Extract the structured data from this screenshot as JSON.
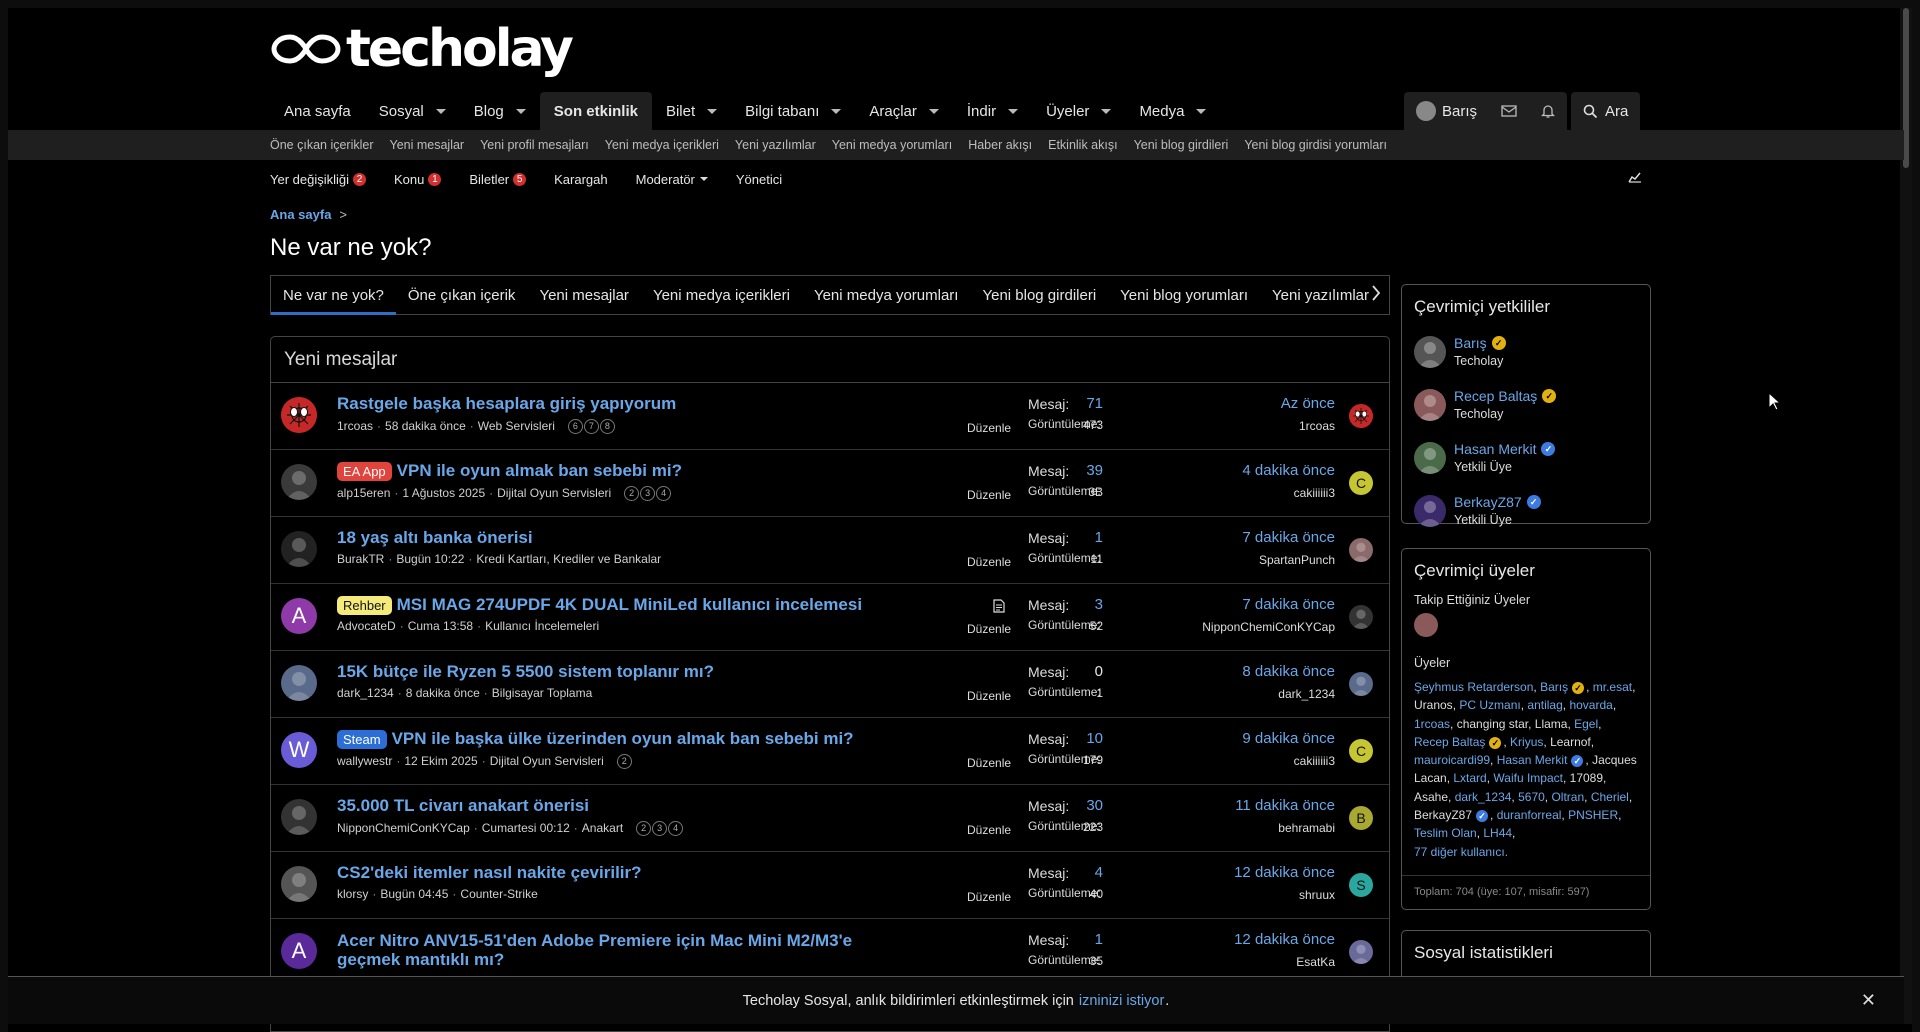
{
  "brand": {
    "logo_text": "techolay"
  },
  "nav": {
    "items": [
      {
        "label": "Ana sayfa",
        "caret": false,
        "active": false
      },
      {
        "label": "Sosyal",
        "caret": true,
        "active": false
      },
      {
        "label": "Blog",
        "caret": true,
        "active": false
      },
      {
        "label": "Son etkinlik",
        "caret": false,
        "active": true
      },
      {
        "label": "Bilet",
        "caret": true,
        "active": false
      },
      {
        "label": "Bilgi tabanı",
        "caret": true,
        "active": false
      },
      {
        "label": "Araçlar",
        "caret": true,
        "active": false
      },
      {
        "label": "İndir",
        "caret": true,
        "active": false
      },
      {
        "label": "Üyeler",
        "caret": true,
        "active": false
      },
      {
        "label": "Medya",
        "caret": true,
        "active": false
      }
    ],
    "user_name": "Barış",
    "search_label": "Ara"
  },
  "subnav": [
    "Öne çıkan içerikler",
    "Yeni mesajlar",
    "Yeni profil mesajları",
    "Yeni medya içerikleri",
    "Yeni yazılımlar",
    "Yeni medya yorumları",
    "Haber akışı",
    "Etkinlik akışı",
    "Yeni blog girdileri",
    "Yeni blog girdisi yorumları"
  ],
  "modbar": {
    "items": [
      {
        "label": "Yer değişikliği",
        "badge": "2"
      },
      {
        "label": "Konu",
        "badge": "1"
      },
      {
        "label": "Biletler",
        "badge": "5"
      },
      {
        "label": "Karargah",
        "badge": ""
      },
      {
        "label": "Moderatör",
        "badge": "",
        "caret": true
      },
      {
        "label": "Yönetici",
        "badge": ""
      }
    ]
  },
  "breadcrumb": {
    "home": "Ana sayfa",
    "sep": ">"
  },
  "page_title": "Ne var ne yok?",
  "tabs": [
    "Ne var ne yok?",
    "Öne çıkan içerik",
    "Yeni mesajlar",
    "Yeni medya içerikleri",
    "Yeni medya yorumları",
    "Yeni blog girdileri",
    "Yeni blog yorumları",
    "Yeni yazılımlar"
  ],
  "block_title": "Yeni mesajlar",
  "stat_labels": {
    "replies": "Mesaj:",
    "views": "Görüntüleme:",
    "edit": "Düzenle"
  },
  "threads": [
    {
      "title": "Rastgele başka hesaplara giriş yapıyorum",
      "prefix": "",
      "author": "1rcoas",
      "date": "58 dakika önce",
      "forum": "Web Servisleri",
      "pages": [
        "6",
        "7",
        "8"
      ],
      "replies": "71",
      "views": "473",
      "last_time": "Az önce",
      "last_user": "1rcoas",
      "av": {
        "type": "spider",
        "color": "#c62828"
      },
      "lav": {
        "type": "spider",
        "color": "#c62828"
      }
    },
    {
      "title": "VPN ile oyun almak ban sebebi mi?",
      "prefix": "EA App",
      "prefix_bg": "#e0443c",
      "prefix_fg": "#ffffff",
      "author": "alp15eren",
      "date": "1 Ağustos 2025",
      "forum": "Dijital Oyun Servisleri",
      "pages": [
        "2",
        "3",
        "4"
      ],
      "replies": "39",
      "views": "3B",
      "last_time": "4 dakika önce",
      "last_user": "cakiiiiii3",
      "av": {
        "type": "photo",
        "color": "#3a3a3a"
      },
      "lav": {
        "type": "letter",
        "letter": "C",
        "color": "#c6c632"
      }
    },
    {
      "title": "18 yaş altı banka önerisi",
      "prefix": "",
      "author": "BurakTR",
      "date": "Bugün 10:22",
      "forum": "Kredi Kartları, Krediler ve Bankalar",
      "pages": [],
      "replies": "1",
      "views": "11",
      "last_time": "7 dakika önce",
      "last_user": "SpartanPunch",
      "av": {
        "type": "photo",
        "color": "#222"
      },
      "lav": {
        "type": "photo",
        "color": "#8a6a6a"
      }
    },
    {
      "title": "MSI MAG 274UPDF 4K DUAL MiniLed kullanıcı incelemesi",
      "prefix": "Rehber",
      "prefix_bg": "#f5eb7a",
      "prefix_fg": "#111111",
      "author": "AdvocateD",
      "date": "Cuma 13:58",
      "forum": "Kullanıcı İncelemeleri",
      "pages": [],
      "replies": "3",
      "views": "52",
      "last_time": "7 dakika önce",
      "last_user": "NipponChemiConKYCap",
      "av": {
        "type": "letter",
        "letter": "A",
        "color": "#8e3aa8"
      },
      "lav": {
        "type": "photo",
        "color": "#333"
      },
      "post_icon": true
    },
    {
      "title": "15K bütçe ile Ryzen 5 5500 sistem toplanır mı?",
      "prefix": "",
      "author": "dark_1234",
      "date": "8 dakika önce",
      "forum": "Bilgisayar Toplama",
      "pages": [],
      "replies": "0",
      "views": "1",
      "last_time": "8 dakika önce",
      "last_user": "dark_1234",
      "av": {
        "type": "photo",
        "color": "#5a6a8a"
      },
      "lav": {
        "type": "photo",
        "color": "#5a6a8a"
      },
      "replies_plain": true
    },
    {
      "title": "VPN ile başka ülke üzerinden oyun almak ban sebebi mi?",
      "prefix": "Steam",
      "prefix_bg": "#2b6fd6",
      "prefix_fg": "#ffffff",
      "author": "wallywestr",
      "date": "12 Ekim 2025",
      "forum": "Dijital Oyun Servisleri",
      "pages": [
        "2"
      ],
      "replies": "10",
      "views": "179",
      "last_time": "9 dakika önce",
      "last_user": "cakiiiiii3",
      "av": {
        "type": "letter",
        "letter": "W",
        "color": "#6a5bd6"
      },
      "lav": {
        "type": "letter",
        "letter": "C",
        "color": "#c6c632"
      }
    },
    {
      "title": "35.000 TL civarı anakart önerisi",
      "prefix": "",
      "author": "NipponChemiConKYCap",
      "date": "Cumartesi 00:12",
      "forum": "Anakart",
      "pages": [
        "2",
        "3",
        "4"
      ],
      "replies": "30",
      "views": "223",
      "last_time": "11 dakika önce",
      "last_user": "behramabi",
      "av": {
        "type": "photo",
        "color": "#333"
      },
      "lav": {
        "type": "letter",
        "letter": "B",
        "color": "#a8a832"
      }
    },
    {
      "title": "CS2'deki itemler nasıl nakite çevirilir?",
      "prefix": "",
      "author": "klorsy",
      "date": "Bugün 04:45",
      "forum": "Counter-Strike",
      "pages": [],
      "replies": "4",
      "views": "40",
      "last_time": "12 dakika önce",
      "last_user": "shruux",
      "av": {
        "type": "photo",
        "color": "#555"
      },
      "lav": {
        "type": "letter",
        "letter": "S",
        "color": "#2aa8a0"
      }
    },
    {
      "title": "Acer Nitro ANV15-51'den Adobe Premiere için Mac Mini M2/M3'e geçmek mantıklı mı?",
      "prefix": "",
      "author": "",
      "date": "",
      "forum": "",
      "pages": [],
      "replies": "1",
      "views": "35",
      "last_time": "12 dakika önce",
      "last_user": "EsatKa",
      "av": {
        "type": "letter",
        "letter": "A",
        "color": "#5a2a9a"
      },
      "lav": {
        "type": "photo",
        "color": "#6a6a9a"
      }
    }
  ],
  "sidebar": {
    "staff_title": "Çevrimiçi yetkililer",
    "staff": [
      {
        "name": "Barış",
        "role": "Techolay",
        "badge": "gold",
        "color": "#555"
      },
      {
        "name": "Recep Baltaş",
        "role": "Techolay",
        "badge": "gold",
        "color": "#8a5a5a"
      },
      {
        "name": "Hasan Merkit",
        "role": "Yetkili Üye",
        "badge": "blue",
        "color": "#4a6a4a"
      },
      {
        "name": "BerkayZ87",
        "role": "Yetkili Üye",
        "badge": "blue",
        "color": "#3a2a6a"
      }
    ],
    "online_title": "Çevrimiçi üyeler",
    "following_label": "Takip Ettiğiniz Üyeler",
    "members_label": "Üyeler",
    "members": [
      {
        "n": "Şeyhmus Retarderson",
        "l": true
      },
      {
        "n": "Barış",
        "l": true,
        "b": "gold"
      },
      {
        "n": "mr.esat",
        "l": true
      },
      {
        "n": "Uranos",
        "l": false
      },
      {
        "n": "PC Uzmanı",
        "l": true
      },
      {
        "n": "antilag",
        "l": true
      },
      {
        "n": "hovarda",
        "l": true
      },
      {
        "n": "1rcoas",
        "l": true
      },
      {
        "n": "changing star",
        "l": false
      },
      {
        "n": "Llama",
        "l": false
      },
      {
        "n": "Egel",
        "l": true
      },
      {
        "n": "Recep Baltaş",
        "l": true,
        "b": "gold"
      },
      {
        "n": "Kriyus",
        "l": true
      },
      {
        "n": "Learnof",
        "l": false
      },
      {
        "n": "mauroicardi99",
        "l": true
      },
      {
        "n": "Hasan Merkit",
        "l": true,
        "b": "blue"
      },
      {
        "n": "Jacques Lacan",
        "l": false
      },
      {
        "n": "Lxtard",
        "l": true
      },
      {
        "n": "Waifu Impact",
        "l": true
      },
      {
        "n": "17089",
        "l": false
      },
      {
        "n": "Asahe",
        "l": false
      },
      {
        "n": "dark_1234",
        "l": true
      },
      {
        "n": "5670",
        "l": true
      },
      {
        "n": "Oltran",
        "l": true
      },
      {
        "n": "Cheriel",
        "l": true
      },
      {
        "n": "BerkayZ87",
        "l": false,
        "b": "blue"
      },
      {
        "n": "duranforreal",
        "l": true
      },
      {
        "n": "PNSHER",
        "l": true
      },
      {
        "n": "Teslim Olan",
        "l": true
      },
      {
        "n": "LH44",
        "l": true
      }
    ],
    "more_users": "77 diğer kullanıcı.",
    "total": "Toplam: 704 (üye: 107, misafir: 597)",
    "social_title": "Sosyal istatistikleri"
  },
  "notice": {
    "text_before": "Techolay Sosyal, anlık bildirimleri etkinleştirmek için",
    "link": "izninizi istiyor",
    "text_after": "."
  },
  "colors": {
    "accent": "#6aa7e8",
    "tab_underline": "#2d6fc4",
    "badge_red": "#d32f2f"
  }
}
